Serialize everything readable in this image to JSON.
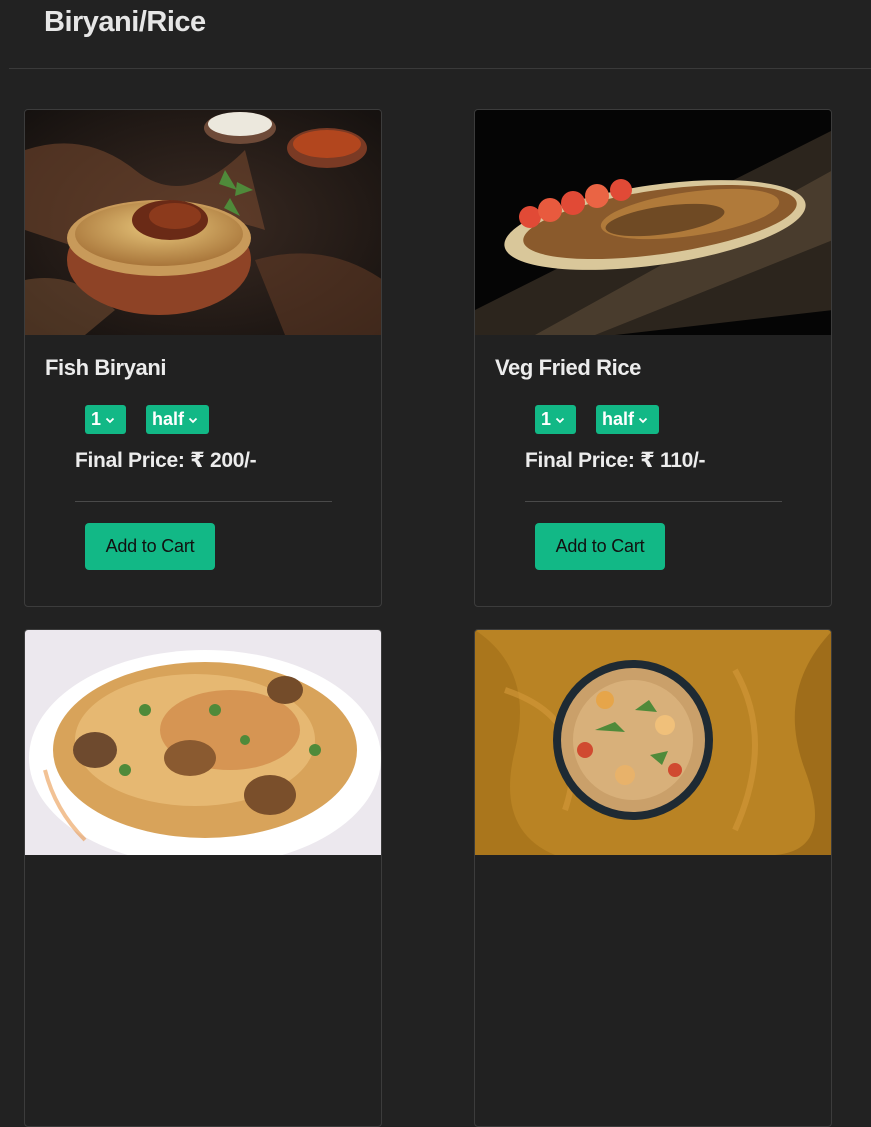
{
  "category": {
    "title": "Biryani/Rice"
  },
  "items": [
    {
      "name": "Fish Biryani",
      "quantity": "1",
      "size": "half",
      "price_label": "Final Price:",
      "price_value": "₹ 200/-",
      "add_label": "Add to Cart"
    },
    {
      "name": "Veg Fried Rice",
      "quantity": "1",
      "size": "half",
      "price_label": "Final Price:",
      "price_value": "₹ 110/-",
      "add_label": "Add to Cart"
    },
    {},
    {}
  ],
  "colors": {
    "background": "#222222",
    "accent": "#12b886",
    "text": "#ececec",
    "card_border": "#3c3c3c"
  },
  "icons": {
    "dropdown": "chevron-down-icon"
  }
}
